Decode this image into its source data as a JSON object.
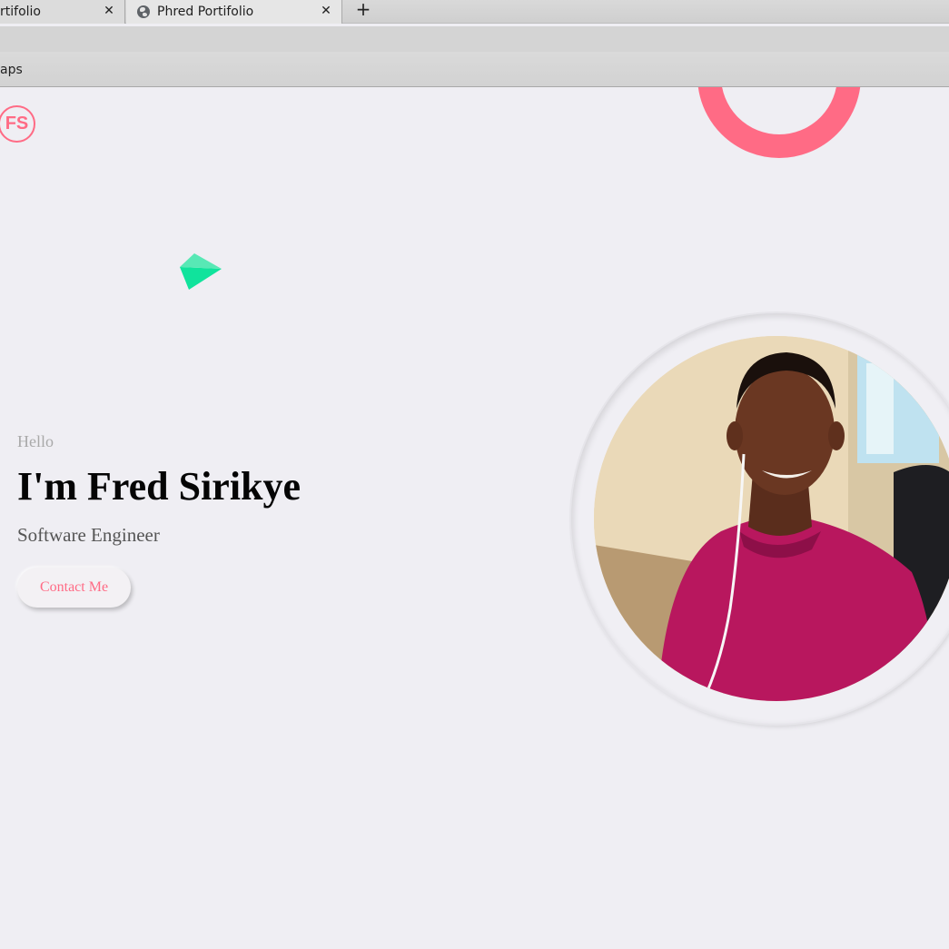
{
  "browser": {
    "tabs": [
      {
        "label": "rtifolio",
        "close": "✕"
      },
      {
        "label": "Phred Portifolio",
        "close": "✕",
        "icon": "globe-icon"
      }
    ],
    "new_tab": "+",
    "bookmarks": [
      "aps"
    ]
  },
  "page": {
    "logo": "FS",
    "hello": "Hello",
    "name": "I'm Fred Sirikye",
    "role": "Software Engineer",
    "contact_button": "Contact Me",
    "accent_color": "#ff6b85",
    "shape_color": "#1de9a0",
    "background": "#efeef3"
  }
}
